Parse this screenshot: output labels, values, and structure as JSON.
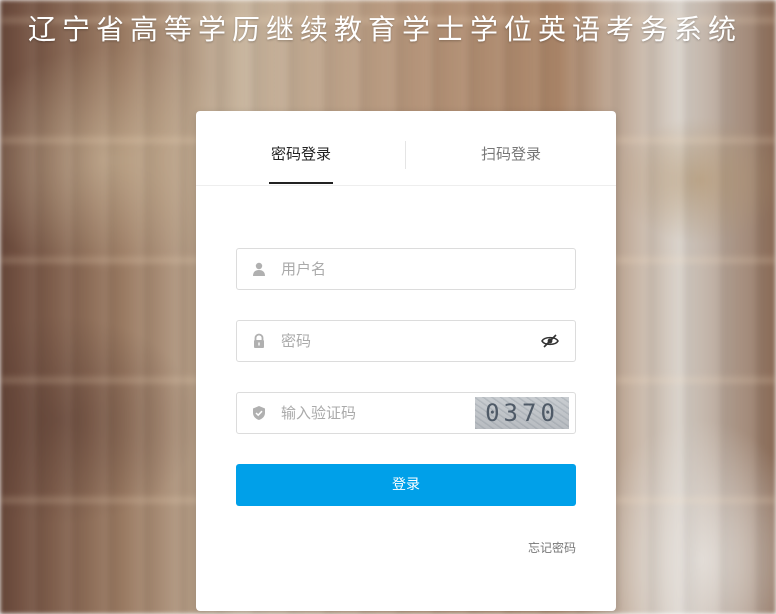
{
  "page": {
    "title": "辽宁省高等学历继续教育学士学位英语考务系统"
  },
  "login": {
    "tabs": [
      {
        "label": "密码登录",
        "active": true
      },
      {
        "label": "扫码登录",
        "active": false
      }
    ],
    "username": {
      "placeholder": "用户名",
      "value": "",
      "icon": "user-icon"
    },
    "password": {
      "placeholder": "密码",
      "value": "",
      "icon": "lock-icon",
      "toggle_icon": "eye-slash-icon"
    },
    "captcha": {
      "placeholder": "输入验证码",
      "value": "",
      "icon": "shield-icon",
      "image_text": "0370"
    },
    "submit_label": "登录",
    "forgot_label": "忘记密码",
    "colors": {
      "accent": "#00a0e9",
      "active_tab": "#222222",
      "inactive_tab": "#777777"
    }
  }
}
